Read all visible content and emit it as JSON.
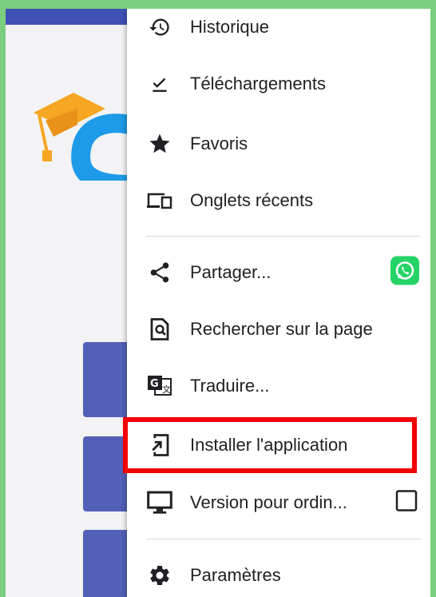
{
  "menu": {
    "history_label": "Historique",
    "downloads_label": "Téléchargements",
    "favorites_label": "Favoris",
    "recent_tabs_label": "Onglets récents",
    "share_label": "Partager...",
    "find_in_page_label": "Rechercher sur la page",
    "translate_label": "Traduire...",
    "install_app_label": "Installer l'application",
    "desktop_version_label": "Version pour ordin...",
    "desktop_version_checked": false,
    "settings_label": "Paramètres"
  },
  "colors": {
    "accent_green": "#7ccf7f",
    "top_bar": "#3f51b5",
    "nav_block": "#5360b7",
    "highlight": "#f20000",
    "whatsapp": "#25d366",
    "logo_cap": "#f5a623",
    "logo_cloud": "#1e9be8"
  },
  "icons": {
    "history": "history-icon",
    "downloads": "download-check-icon",
    "favorites": "star-icon",
    "recent_tabs": "devices-icon",
    "share": "share-icon",
    "whatsapp": "whatsapp-icon",
    "find": "find-in-page-icon",
    "translate": "translate-icon",
    "install": "install-app-icon",
    "desktop": "monitor-icon",
    "settings": "gear-icon"
  }
}
